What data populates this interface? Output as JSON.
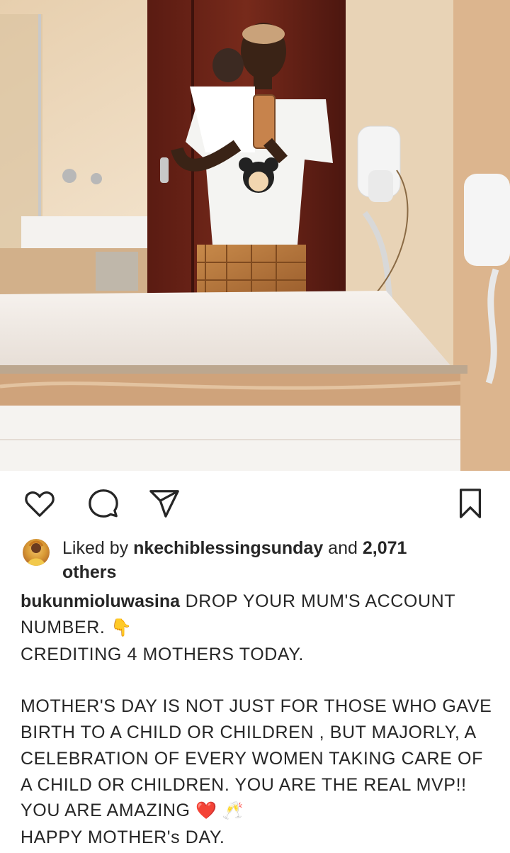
{
  "post": {
    "image_alt": "Mirror selfie of a woman holding a baby in a bathroom",
    "actions": {
      "like_icon": "heart-icon",
      "comment_icon": "comment-icon",
      "share_icon": "send-icon",
      "save_icon": "bookmark-icon"
    },
    "likes": {
      "prefix": "Liked by",
      "user": "nkechiblessingsunday",
      "conjunction": "and",
      "count": "2,071",
      "suffix": "others"
    },
    "caption": {
      "username": "bukunmioluwasina",
      "line1": "DROP YOUR MUM'S ACCOUNT NUMBER.",
      "line1_emoji": "👇",
      "line2": "CREDITING 4 MOTHERS TODAY.",
      "para1": "MOTHER'S DAY IS NOT JUST FOR THOSE WHO GAVE BIRTH TO A CHILD OR CHILDREN , BUT MAJORLY, A CELEBRATION OF EVERY WOMEN TAKING CARE OF A CHILD OR CHILDREN. YOU ARE THE REAL MVP!! YOU ARE AMAZING",
      "para1_emoji": "❤️ 🥂",
      "para2": "HAPPY MOTHER's DAY."
    }
  },
  "colors": {
    "text": "#262626",
    "background": "#ffffff"
  }
}
